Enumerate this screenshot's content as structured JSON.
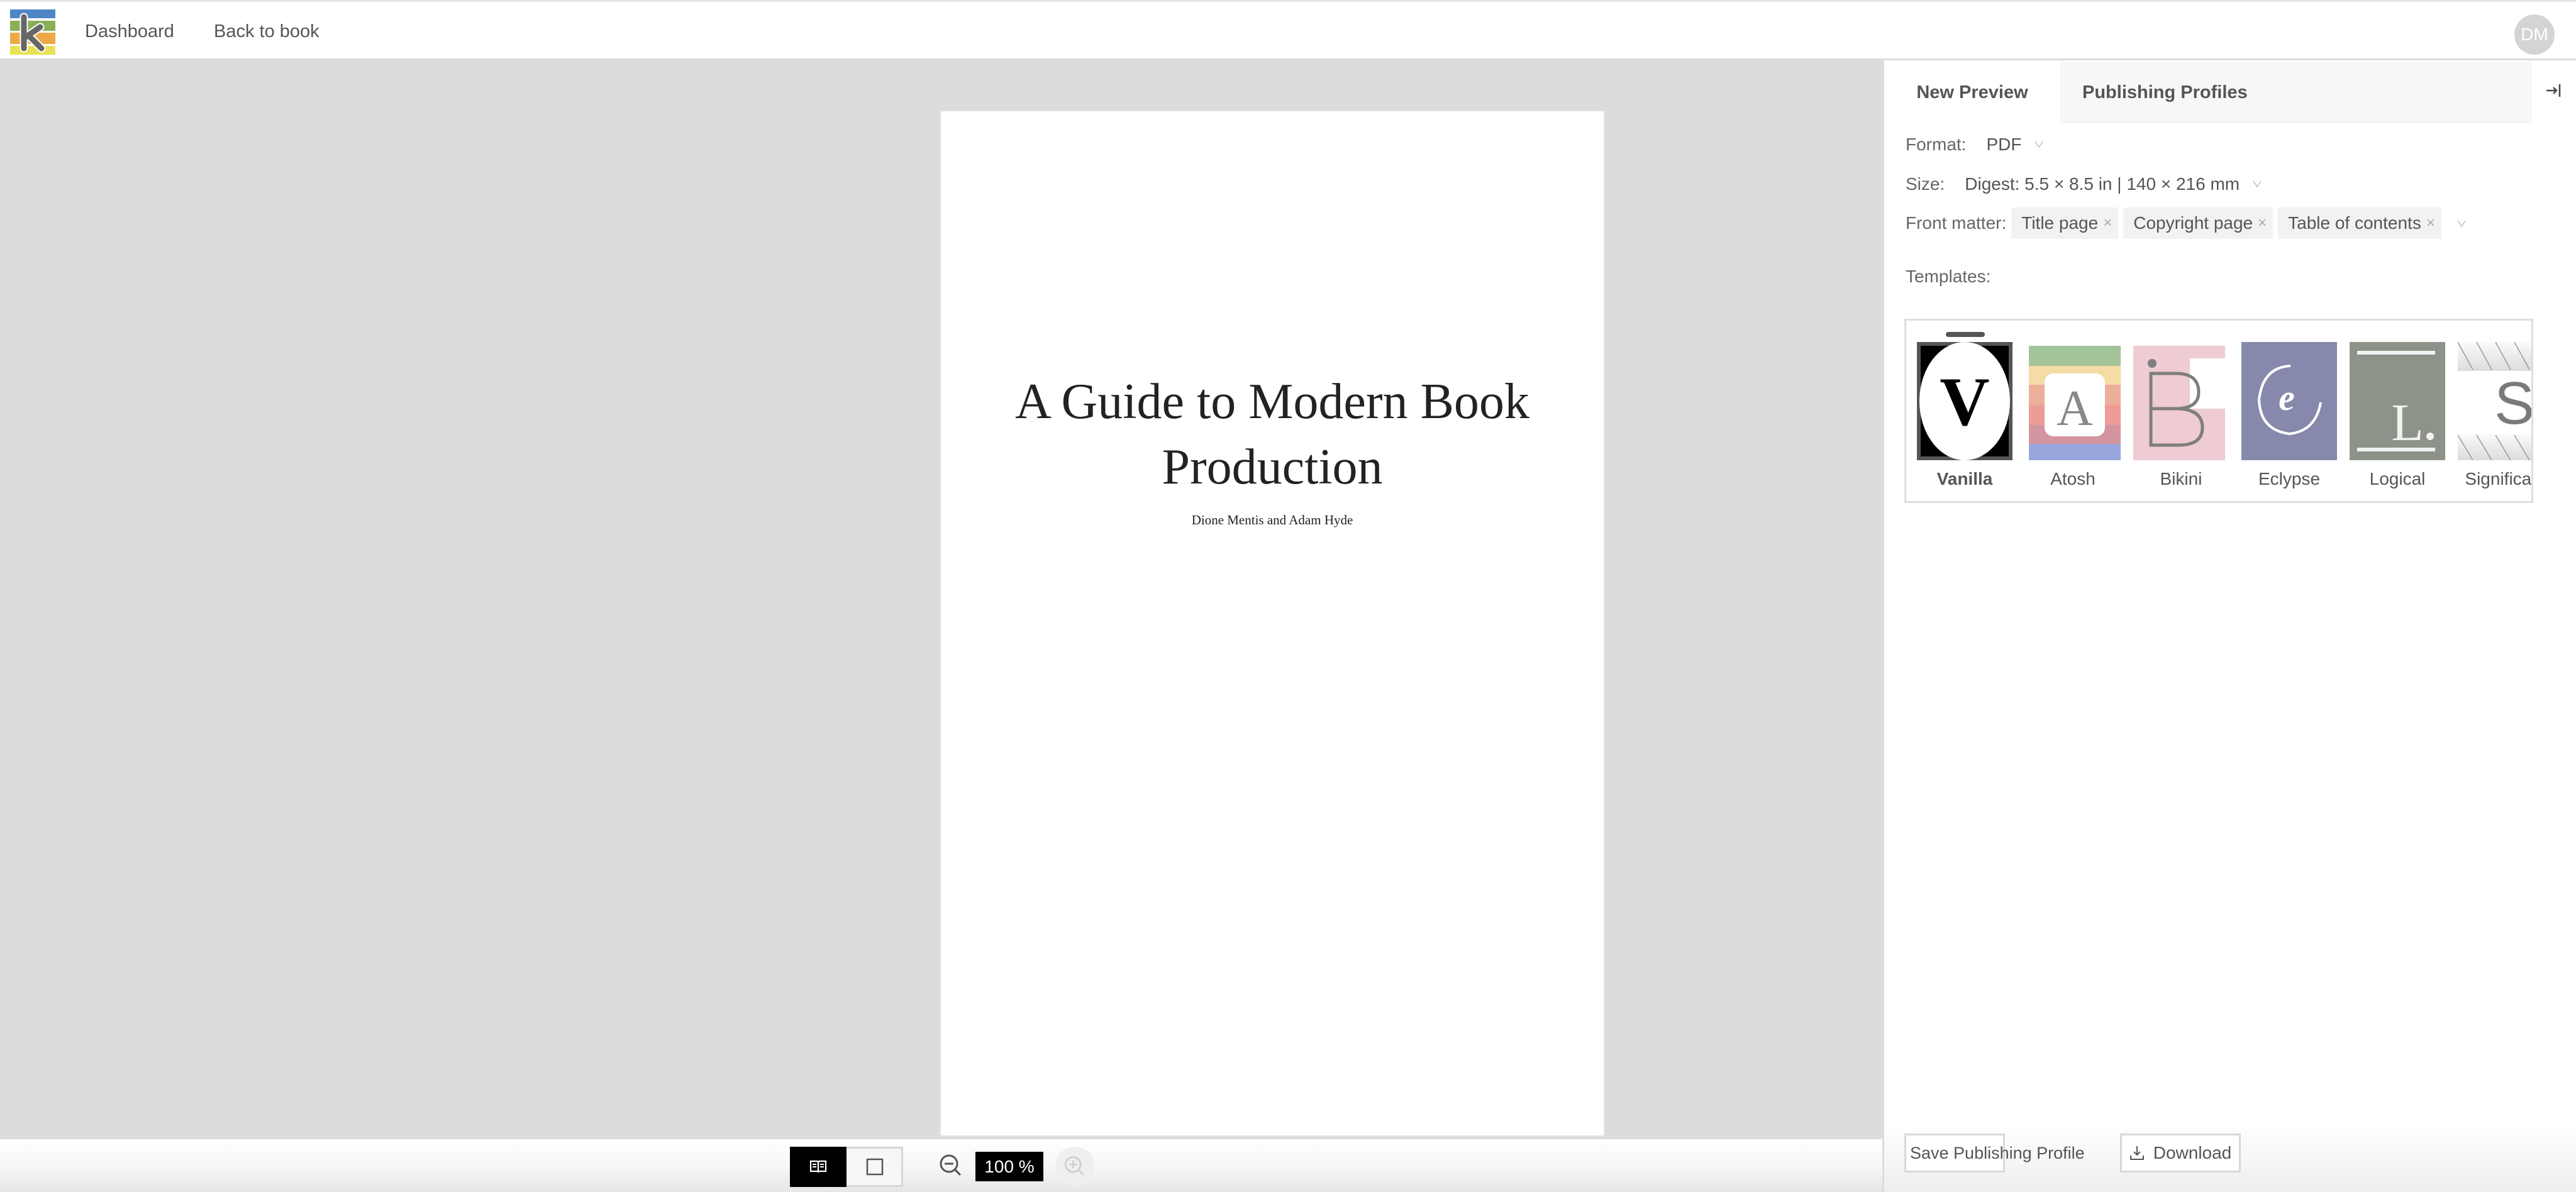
{
  "header": {
    "logo_letter": "k",
    "nav": [
      {
        "label": "Dashboard"
      },
      {
        "label": "Back to book"
      }
    ],
    "avatar_initials": "DM"
  },
  "preview": {
    "book_title": "A Guide to Modern Book Production",
    "book_authors": "Dione Mentis and Adam Hyde",
    "view_modes": [
      {
        "name": "spread",
        "icon": "open-book-icon",
        "active": true
      },
      {
        "name": "single",
        "icon": "single-page-icon",
        "active": false
      }
    ],
    "zoom_level": "100 %"
  },
  "sidebar": {
    "tabs": [
      {
        "label": "New Preview",
        "active": true
      },
      {
        "label": "Publishing Profiles",
        "active": false
      }
    ],
    "format": {
      "label": "Format:",
      "value": "PDF"
    },
    "size": {
      "label": "Size:",
      "value": "Digest: 5.5 × 8.5 in | 140 × 216 mm"
    },
    "front_matter": {
      "label": "Front matter:",
      "tags": [
        "Title page",
        "Copyright page",
        "Table of contents"
      ]
    },
    "templates": {
      "label": "Templates:",
      "items": [
        {
          "name": "Vanilla",
          "selected": true,
          "glyph": "V"
        },
        {
          "name": "Atosh",
          "selected": false,
          "glyph": "A"
        },
        {
          "name": "Bikini",
          "selected": false,
          "glyph": "B"
        },
        {
          "name": "Eclypse",
          "selected": false,
          "glyph": "e"
        },
        {
          "name": "Logical",
          "selected": false,
          "glyph": "L."
        },
        {
          "name": "Significant",
          "selected": false,
          "glyph": "S"
        }
      ]
    },
    "buttons": {
      "save_profile": "Save Publishing Profile",
      "download": "Download"
    }
  },
  "colors": {
    "logo_stripes": [
      "#4f86c6",
      "#8aaf55",
      "#eda946",
      "#e8e254"
    ],
    "atosh_stripes": [
      "#a3c49a",
      "#f5dba6",
      "#ebaf9a",
      "#ed9c98",
      "#d396a0",
      "#97a7de"
    ],
    "bikini_bg": "#efcbd3",
    "eclypse_bg": "#8689ab",
    "logical_bg": "#8d9389"
  }
}
